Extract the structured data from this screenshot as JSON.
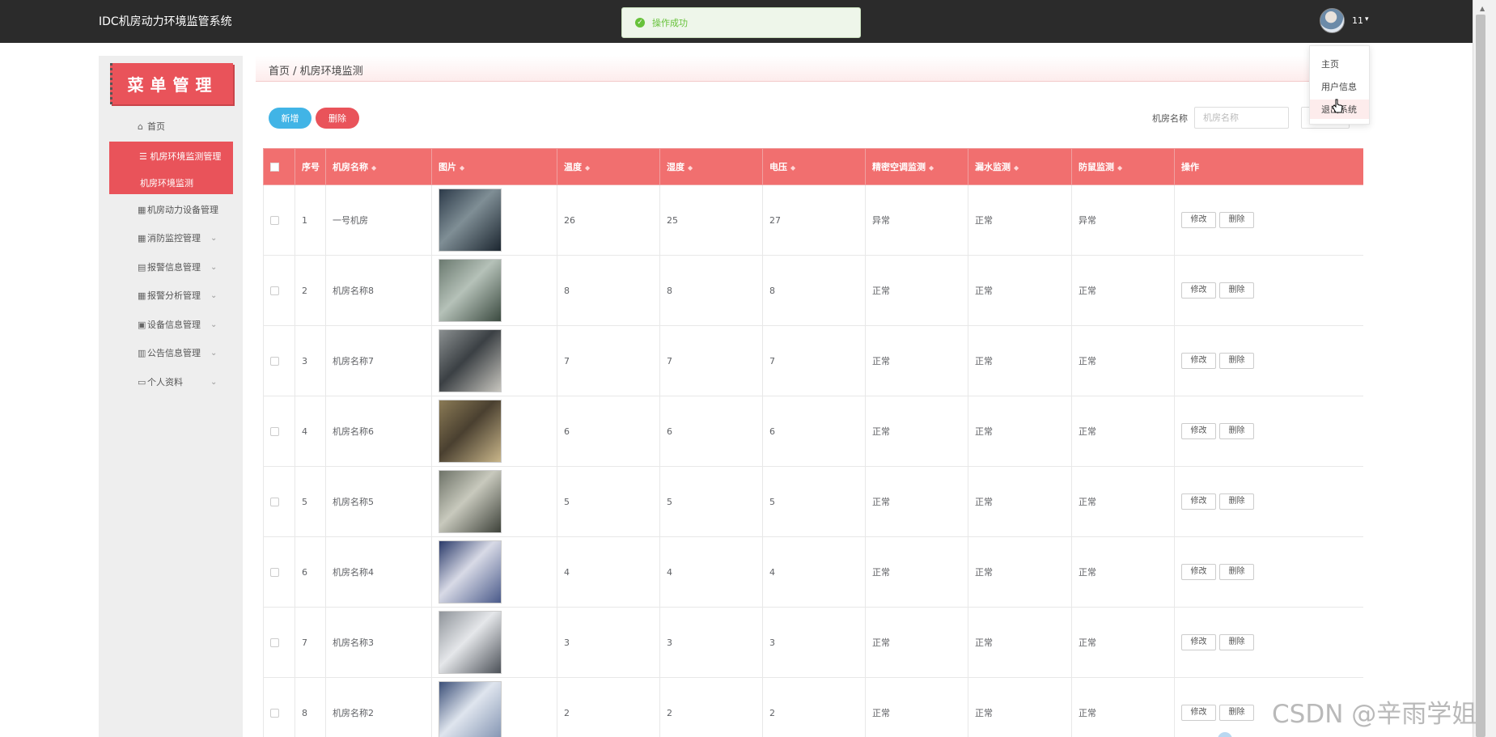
{
  "app": {
    "title": "IDC机房动力环境监管系统"
  },
  "toast": {
    "message": "操作成功",
    "icon": "check-circle-icon",
    "color": "#67c23a"
  },
  "user": {
    "name": "11",
    "caret": "▾"
  },
  "user_menu": {
    "items": [
      "主页",
      "用户信息",
      "退出系统"
    ]
  },
  "colors": {
    "accent": "#e9535a",
    "header_bg": "#f16f6f",
    "add_button": "#41b4e6",
    "topbar": "#2b2b2b"
  },
  "sidebar": {
    "banner": "菜单管理",
    "home": "首页",
    "group_active": "机房环境监测管理",
    "group_active_child": "机房环境监测",
    "items": [
      "机房动力设备管理",
      "消防监控管理",
      "报警信息管理",
      "报警分析管理",
      "设备信息管理",
      "公告信息管理",
      "个人资料"
    ]
  },
  "breadcrumb": "首页 / 机房环境监测",
  "toolbar": {
    "add_label": "新增",
    "delete_label": "删除"
  },
  "search": {
    "label": "机房名称",
    "placeholder": "机房名称"
  },
  "table": {
    "headers": [
      "序号",
      "机房名称",
      "图片",
      "温度",
      "湿度",
      "电压",
      "精密空调监测",
      "漏水监测",
      "防鼠监测",
      "操作"
    ],
    "edit_label": "修改",
    "delete_label": "删除",
    "rows": [
      {
        "no": "1",
        "name": "一号机房",
        "temp": "26",
        "humidity": "25",
        "voltage": "27",
        "ac": "异常",
        "leak": "正常",
        "rodent": "异常"
      },
      {
        "no": "2",
        "name": "机房名称8",
        "temp": "8",
        "humidity": "8",
        "voltage": "8",
        "ac": "正常",
        "leak": "正常",
        "rodent": "正常"
      },
      {
        "no": "3",
        "name": "机房名称7",
        "temp": "7",
        "humidity": "7",
        "voltage": "7",
        "ac": "正常",
        "leak": "正常",
        "rodent": "正常"
      },
      {
        "no": "4",
        "name": "机房名称6",
        "temp": "6",
        "humidity": "6",
        "voltage": "6",
        "ac": "正常",
        "leak": "正常",
        "rodent": "正常"
      },
      {
        "no": "5",
        "name": "机房名称5",
        "temp": "5",
        "humidity": "5",
        "voltage": "5",
        "ac": "正常",
        "leak": "正常",
        "rodent": "正常"
      },
      {
        "no": "6",
        "name": "机房名称4",
        "temp": "4",
        "humidity": "4",
        "voltage": "4",
        "ac": "正常",
        "leak": "正常",
        "rodent": "正常"
      },
      {
        "no": "7",
        "name": "机房名称3",
        "temp": "3",
        "humidity": "3",
        "voltage": "3",
        "ac": "正常",
        "leak": "正常",
        "rodent": "正常"
      },
      {
        "no": "8",
        "name": "机房名称2",
        "temp": "2",
        "humidity": "2",
        "voltage": "2",
        "ac": "正常",
        "leak": "正常",
        "rodent": "正常"
      }
    ]
  },
  "watermark": "CSDN @辛雨学姐"
}
